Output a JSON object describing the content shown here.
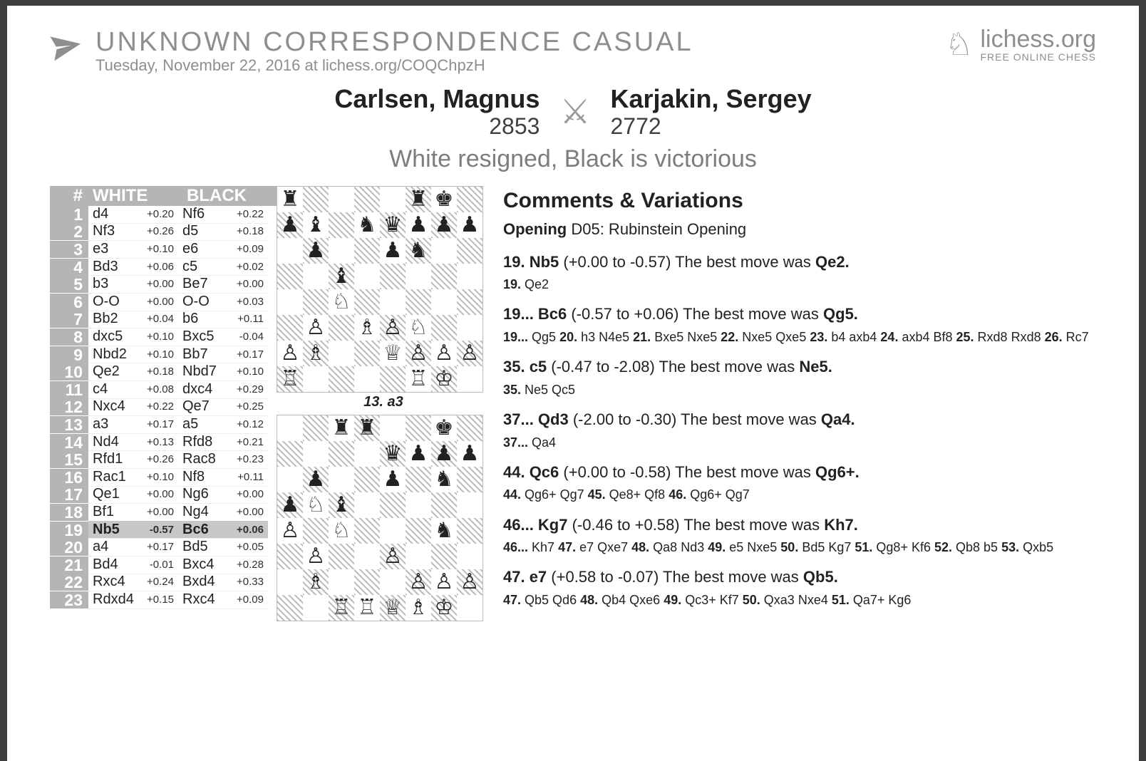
{
  "header": {
    "title": "UNKNOWN   CORRESPONDENCE   CASUAL",
    "subtitle": "Tuesday, November 22, 2016 at lichess.org/COQChpzH",
    "brand_name": "lichess.org",
    "brand_tag": "FREE ONLINE CHESS"
  },
  "players": {
    "white_name": "Carlsen, Magnus",
    "white_rating": "2853",
    "black_name": "Karjakin, Sergey",
    "black_rating": "2772",
    "result": "White resigned, Black is victorious"
  },
  "moves_header": {
    "num": "#",
    "white": "WHITE",
    "black": "BLACK"
  },
  "moves": [
    {
      "n": "1",
      "w": "d4",
      "we": "+0.20",
      "b": "Nf6",
      "be": "+0.22"
    },
    {
      "n": "2",
      "w": "Nf3",
      "we": "+0.26",
      "b": "d5",
      "be": "+0.18"
    },
    {
      "n": "3",
      "w": "e3",
      "we": "+0.10",
      "b": "e6",
      "be": "+0.09"
    },
    {
      "n": "4",
      "w": "Bd3",
      "we": "+0.06",
      "b": "c5",
      "be": "+0.02"
    },
    {
      "n": "5",
      "w": "b3",
      "we": "+0.00",
      "b": "Be7",
      "be": "+0.00"
    },
    {
      "n": "6",
      "w": "O-O",
      "we": "+0.00",
      "b": "O-O",
      "be": "+0.03"
    },
    {
      "n": "7",
      "w": "Bb2",
      "we": "+0.04",
      "b": "b6",
      "be": "+0.11"
    },
    {
      "n": "8",
      "w": "dxc5",
      "we": "+0.10",
      "b": "Bxc5",
      "be": "-0.04"
    },
    {
      "n": "9",
      "w": "Nbd2",
      "we": "+0.10",
      "b": "Bb7",
      "be": "+0.17"
    },
    {
      "n": "10",
      "w": "Qe2",
      "we": "+0.18",
      "b": "Nbd7",
      "be": "+0.10"
    },
    {
      "n": "11",
      "w": "c4",
      "we": "+0.08",
      "b": "dxc4",
      "be": "+0.29"
    },
    {
      "n": "12",
      "w": "Nxc4",
      "we": "+0.22",
      "b": "Qe7",
      "be": "+0.25"
    },
    {
      "n": "13",
      "w": "a3",
      "we": "+0.17",
      "b": "a5",
      "be": "+0.12"
    },
    {
      "n": "14",
      "w": "Nd4",
      "we": "+0.13",
      "b": "Rfd8",
      "be": "+0.21"
    },
    {
      "n": "15",
      "w": "Rfd1",
      "we": "+0.26",
      "b": "Rac8",
      "be": "+0.23"
    },
    {
      "n": "16",
      "w": "Rac1",
      "we": "+0.10",
      "b": "Nf8",
      "be": "+0.11"
    },
    {
      "n": "17",
      "w": "Qe1",
      "we": "+0.00",
      "b": "Ng6",
      "be": "+0.00"
    },
    {
      "n": "18",
      "w": "Bf1",
      "we": "+0.00",
      "b": "Ng4",
      "be": "+0.00"
    },
    {
      "n": "19",
      "w": "Nb5",
      "we": "-0.57",
      "b": "Bc6",
      "be": "+0.06",
      "wh": true,
      "bh": true
    },
    {
      "n": "20",
      "w": "a4",
      "we": "+0.17",
      "b": "Bd5",
      "be": "+0.05"
    },
    {
      "n": "21",
      "w": "Bd4",
      "we": "-0.01",
      "b": "Bxc4",
      "be": "+0.28"
    },
    {
      "n": "22",
      "w": "Rxc4",
      "we": "+0.24",
      "b": "Bxd4",
      "be": "+0.33"
    },
    {
      "n": "23",
      "w": "Rdxd4",
      "we": "+0.15",
      "b": "Rxc4",
      "be": "+0.09"
    }
  ],
  "boards": [
    {
      "caption": "13. a3",
      "fen": "r4rk1/pb1nqppp/1p2pn2/2b5/2N5/1P1BPN2/PB2QPPP/R4RK1"
    },
    {
      "caption": "",
      "fen": "2rr2k1/4qppp/1p2p1n1/pNb5/P1N3n1/1P2P3/1B3PPP/2RRQBK1"
    }
  ],
  "comments": {
    "title": "Comments & Variations",
    "opening_label": "Opening",
    "opening_name": "D05: Rubinstein Opening",
    "annotations": [
      {
        "head_parts": [
          "19. Nb5",
          " (+0.00 to -0.57) The best move was ",
          "Qe2."
        ],
        "pv_parts": [
          [
            "19.",
            "Qe2"
          ]
        ]
      },
      {
        "head_parts": [
          "19... Bc6",
          " (-0.57 to +0.06) The best move was ",
          "Qg5."
        ],
        "pv_parts": [
          [
            "19...",
            "Qg5"
          ],
          [
            "20.",
            "h3 N4e5"
          ],
          [
            "21.",
            "Bxe5 Nxe5"
          ],
          [
            "22.",
            "Nxe5 Qxe5"
          ],
          [
            "23.",
            "b4 axb4"
          ],
          [
            "24.",
            "axb4 Bf8"
          ],
          [
            "25.",
            "Rxd8 Rxd8"
          ],
          [
            "26.",
            "Rc7"
          ]
        ]
      },
      {
        "head_parts": [
          "35. c5",
          " (-0.47 to -2.08) The best move was ",
          "Ne5."
        ],
        "pv_parts": [
          [
            "35.",
            "Ne5 Qc5"
          ]
        ]
      },
      {
        "head_parts": [
          "37... Qd3",
          " (-2.00 to -0.30) The best move was ",
          "Qa4."
        ],
        "pv_parts": [
          [
            "37...",
            "Qa4"
          ]
        ]
      },
      {
        "head_parts": [
          "44. Qc6",
          " (+0.00 to -0.58) The best move was ",
          "Qg6+."
        ],
        "pv_parts": [
          [
            "44.",
            "Qg6+ Qg7"
          ],
          [
            "45.",
            "Qe8+ Qf8"
          ],
          [
            "46.",
            "Qg6+ Qg7"
          ]
        ]
      },
      {
        "head_parts": [
          "46... Kg7",
          " (-0.46 to +0.58) The best move was ",
          "Kh7."
        ],
        "pv_parts": [
          [
            "46...",
            "Kh7"
          ],
          [
            "47.",
            "e7 Qxe7"
          ],
          [
            "48.",
            "Qa8 Nd3"
          ],
          [
            "49.",
            "e5 Nxe5"
          ],
          [
            "50.",
            "Bd5 Kg7"
          ],
          [
            "51.",
            "Qg8+ Kf6"
          ],
          [
            "52.",
            "Qb8 b5"
          ],
          [
            "53.",
            "Qxb5"
          ]
        ]
      },
      {
        "head_parts": [
          "47. e7",
          " (+0.58 to -0.07) The best move was ",
          "Qb5."
        ],
        "pv_parts": [
          [
            "47.",
            "Qb5 Qd6"
          ],
          [
            "48.",
            "Qb4 Qxe6"
          ],
          [
            "49.",
            "Qc3+ Kf7"
          ],
          [
            "50.",
            "Qxa3 Nxe4"
          ],
          [
            "51.",
            "Qa7+ Kg6"
          ]
        ]
      }
    ]
  }
}
